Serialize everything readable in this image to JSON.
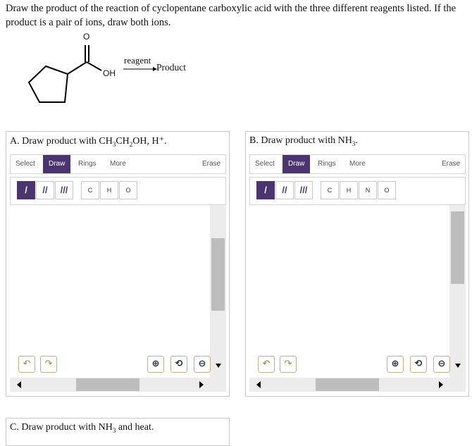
{
  "question": "Draw the product of the reaction of cyclopentane carboxylic acid with the three different reagents listed. If the product is a pair of ions, draw both ions.",
  "scheme": {
    "atom_o": "O",
    "atom_oh": "OH",
    "reagent": "reagent",
    "product": "Product"
  },
  "panelA": {
    "title_pre": "A. Draw product with CH",
    "sub1": "3",
    "mid1": "CH",
    "sub2": "2",
    "title_post": "OH, H⁺.",
    "toolbar": [
      "Select",
      "Draw",
      "Rings",
      "More",
      "Erase"
    ],
    "atoms": [
      "C",
      "H",
      "O"
    ]
  },
  "panelB": {
    "title_pre": "B. Draw product with NH",
    "sub1": "3",
    "title_post": ".",
    "toolbar": [
      "Select",
      "Draw",
      "Rings",
      "More",
      "Erase"
    ],
    "atoms": [
      "C",
      "H",
      "N",
      "O"
    ]
  },
  "panelC": {
    "title_pre": "C. Draw product with NH",
    "sub1": "3",
    "title_post": " and heat."
  },
  "bonds": [
    "/",
    "//",
    "///"
  ],
  "icons": {
    "undo": "undo-icon",
    "redo": "redo-icon",
    "zoom_in": "zoom-in-icon",
    "zoom_reset": "zoom-reset-icon",
    "zoom_out": "zoom-out-icon"
  },
  "colors": {
    "accent": "#4a3570",
    "control_border": "#b9b28a",
    "control_icon": "#a08c35"
  }
}
